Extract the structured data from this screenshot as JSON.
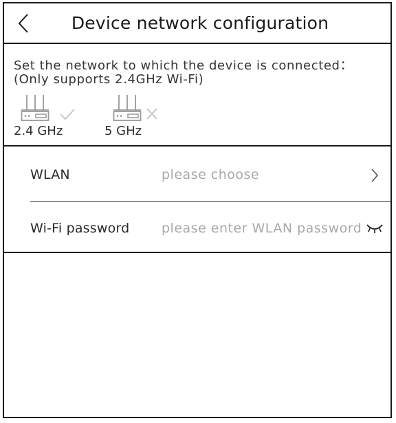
{
  "header": {
    "title": "Device network configuration",
    "back_icon": "chevron-left-icon"
  },
  "info": {
    "line1": "Set the network to which the device is connected：",
    "line2": "(Only supports 2.4GHz Wi-Fi)",
    "bands": [
      {
        "label": "2.4 GHz",
        "icon": "router-icon",
        "status_icon": "check-icon",
        "supported": true
      },
      {
        "label": "5 GHz",
        "icon": "router-icon",
        "status_icon": "cross-icon",
        "supported": false
      }
    ]
  },
  "form": {
    "wlan": {
      "label": "WLAN",
      "placeholder": "please choose",
      "icon": "chevron-right-icon"
    },
    "password": {
      "label": "Wi-Fi password",
      "placeholder": "please enter WLAN password",
      "icon": "eye-closed-icon"
    }
  },
  "colors": {
    "border": "#1a1a1a",
    "text": "#333333",
    "placeholder": "#a8a8a8",
    "status_mark": "#cccccc"
  }
}
